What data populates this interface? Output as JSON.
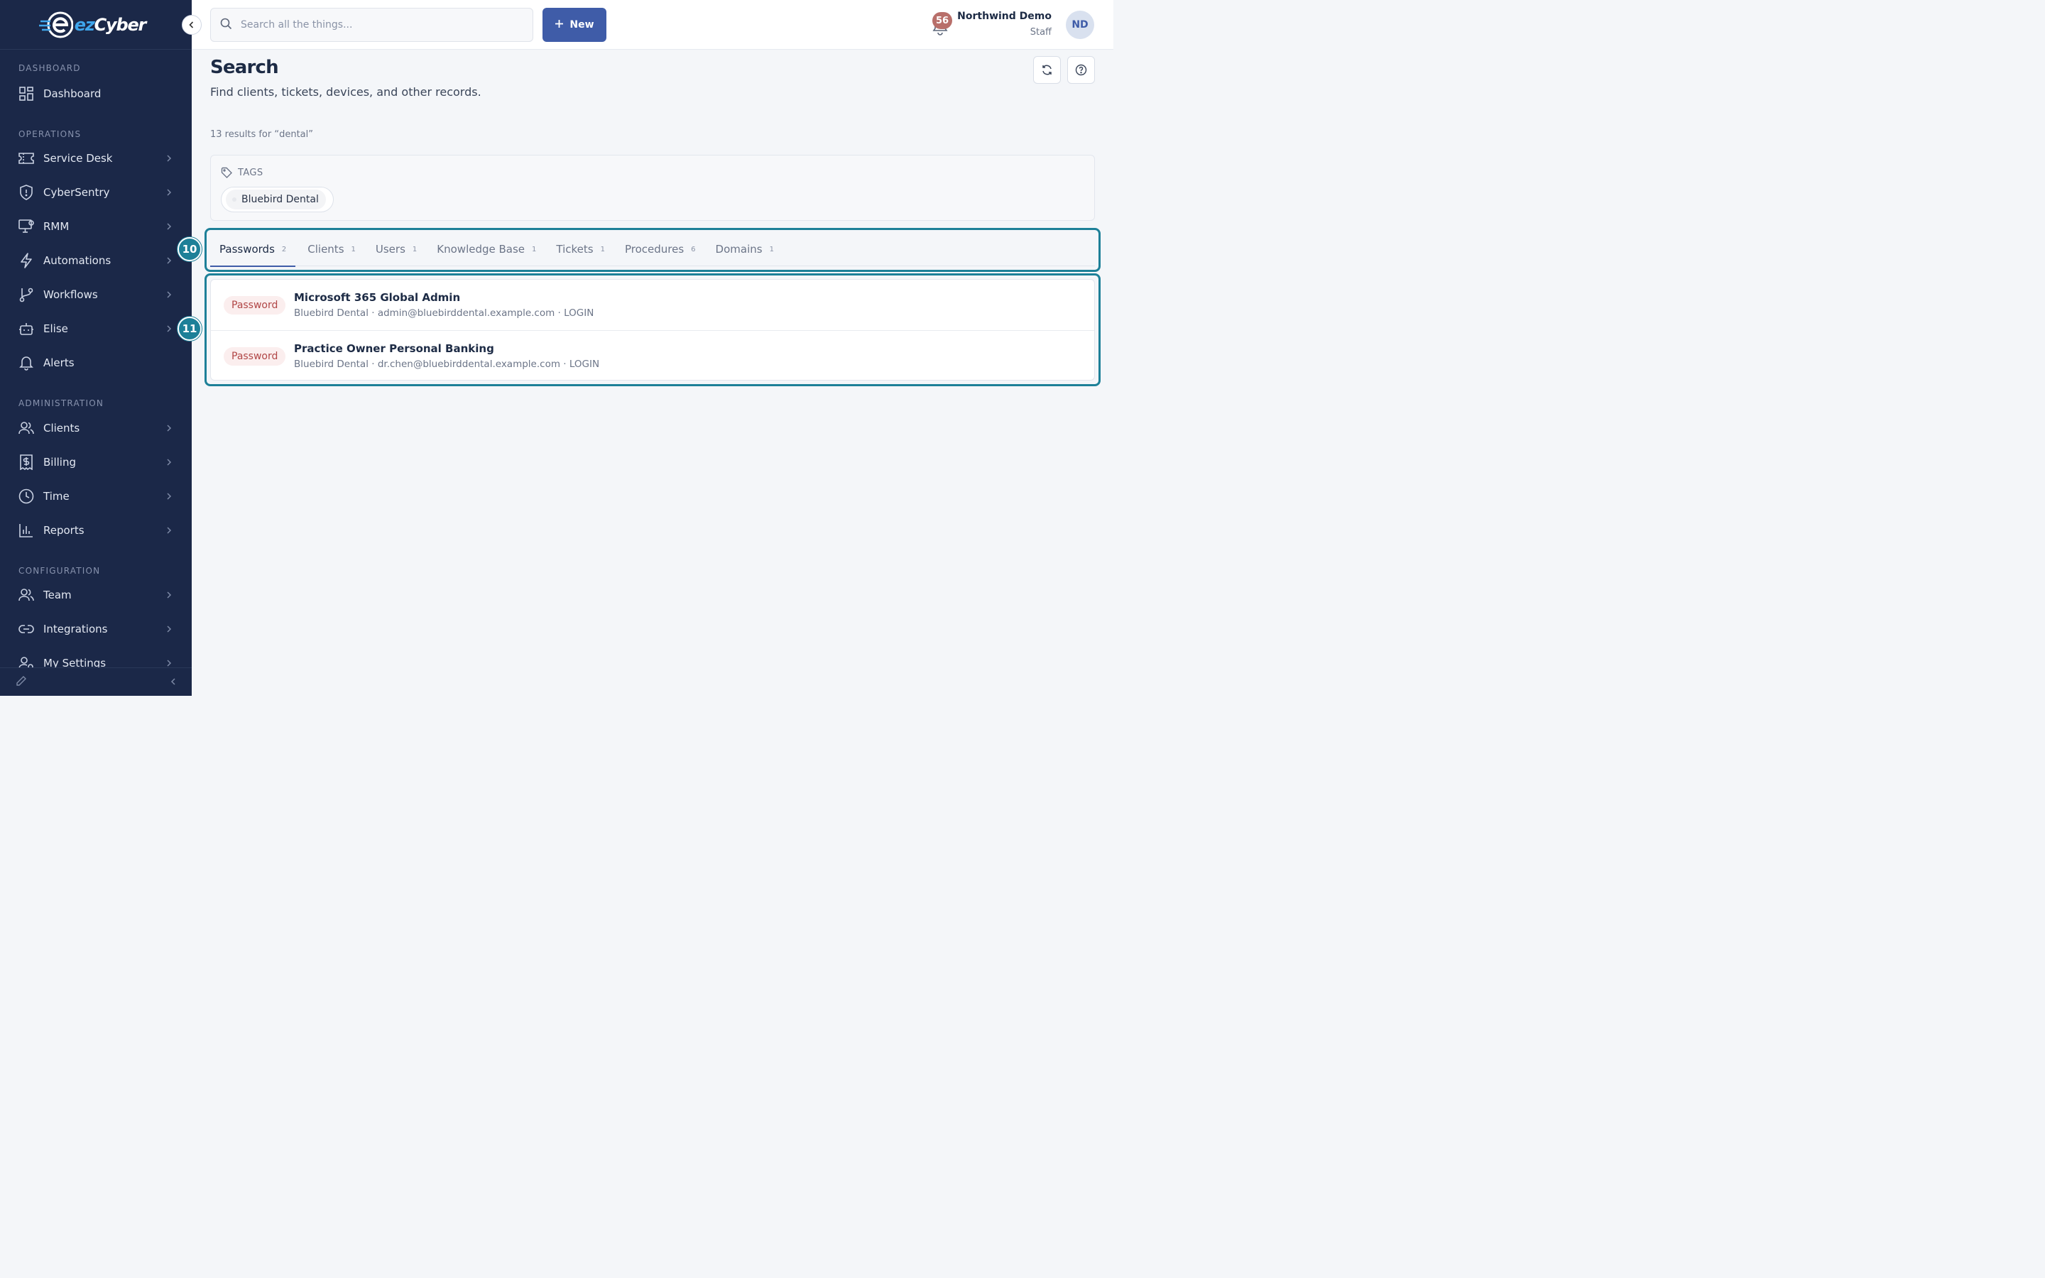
{
  "app": {
    "logo_prefix": "ez",
    "logo_suffix": "Cyber"
  },
  "sidebar": {
    "sections": [
      {
        "label": "DASHBOARD"
      },
      {
        "label": "OPERATIONS"
      },
      {
        "label": "ADMINISTRATION"
      },
      {
        "label": "CONFIGURATION"
      }
    ],
    "items": [
      {
        "label": "Dashboard",
        "icon": "dashboard-grid-icon"
      },
      {
        "label": "Service Desk",
        "icon": "ticket-icon"
      },
      {
        "label": "CyberSentry",
        "icon": "shield-icon"
      },
      {
        "label": "RMM",
        "icon": "monitor-icon"
      },
      {
        "label": "Automations",
        "icon": "lightning-icon"
      },
      {
        "label": "Workflows",
        "icon": "branch-icon"
      },
      {
        "label": "Elise",
        "icon": "robot-icon"
      },
      {
        "label": "Alerts",
        "icon": "bell-icon"
      },
      {
        "label": "Clients",
        "icon": "users-icon"
      },
      {
        "label": "Billing",
        "icon": "dollar-receipt-icon"
      },
      {
        "label": "Time",
        "icon": "clock-icon"
      },
      {
        "label": "Reports",
        "icon": "bar-chart-icon"
      },
      {
        "label": "Team",
        "icon": "team-icon"
      },
      {
        "label": "Integrations",
        "icon": "link-icon"
      },
      {
        "label": "My Settings",
        "icon": "user-settings-icon"
      }
    ]
  },
  "topbar": {
    "search_placeholder": "Search all the things...",
    "new_label": "New",
    "notification_count": "56",
    "user_name": "Northwind Demo",
    "user_role": "Staff",
    "user_initials": "ND"
  },
  "page": {
    "title": "Search",
    "subtitle": "Find clients, tickets, devices, and other records.",
    "results_count": "13 results for “dental”"
  },
  "tags": {
    "heading": "TAGS",
    "items": [
      "Bluebird Dental"
    ]
  },
  "tabs": [
    {
      "label": "Passwords",
      "count": "2"
    },
    {
      "label": "Clients",
      "count": "1"
    },
    {
      "label": "Users",
      "count": "1"
    },
    {
      "label": "Knowledge Base",
      "count": "1"
    },
    {
      "label": "Tickets",
      "count": "1"
    },
    {
      "label": "Procedures",
      "count": "6"
    },
    {
      "label": "Domains",
      "count": "1"
    }
  ],
  "results": [
    {
      "badge": "Password",
      "title": "Microsoft 365 Global Admin",
      "meta": "Bluebird Dental · admin@bluebirddental.example.com · LOGIN"
    },
    {
      "badge": "Password",
      "title": "Practice Owner Personal Banking",
      "meta": "Bluebird Dental · dr.chen@bluebirddental.example.com · LOGIN"
    }
  ],
  "annotations": {
    "tabs_marker": "10",
    "results_marker": "11"
  },
  "colors": {
    "sidebar_bg": "#1b2848",
    "accent": "#3f5ca8",
    "highlight": "#1d8098",
    "password_badge": "#b14646"
  }
}
